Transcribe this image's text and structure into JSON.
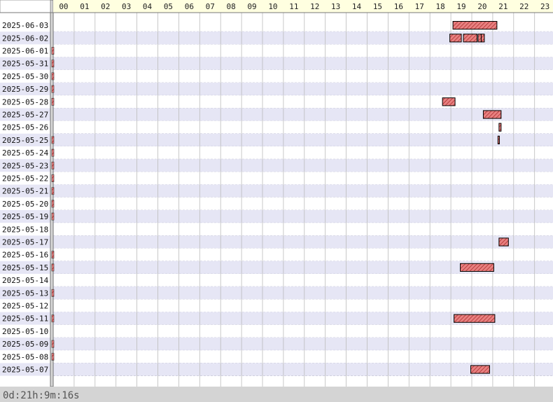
{
  "chart_data": {
    "type": "timeline",
    "hours": [
      "00",
      "01",
      "02",
      "03",
      "04",
      "05",
      "06",
      "07",
      "08",
      "09",
      "10",
      "11",
      "12",
      "13",
      "14",
      "15",
      "16",
      "17",
      "18",
      "19",
      "20",
      "21",
      "22",
      "23"
    ],
    "dates": [
      "2025-06-03",
      "2025-06-02",
      "2025-06-01",
      "2025-05-31",
      "2025-05-30",
      "2025-05-29",
      "2025-05-28",
      "2025-05-27",
      "2025-05-26",
      "2025-05-25",
      "2025-05-24",
      "2025-05-23",
      "2025-05-22",
      "2025-05-21",
      "2025-05-20",
      "2025-05-19",
      "2025-05-18",
      "2025-05-17",
      "2025-05-16",
      "2025-05-15",
      "2025-05-14",
      "2025-05-13",
      "2025-05-12",
      "2025-05-11",
      "2025-05-10",
      "2025-05-09",
      "2025-05-08",
      "2025-05-07"
    ],
    "marked_dates": [
      "2025-06-01",
      "2025-05-31",
      "2025-05-30",
      "2025-05-29",
      "2025-05-28",
      "2025-05-25",
      "2025-05-24",
      "2025-05-23",
      "2025-05-22",
      "2025-05-21",
      "2025-05-20",
      "2025-05-19",
      "2025-05-16",
      "2025-05-15",
      "2025-05-13",
      "2025-05-11",
      "2025-05-09",
      "2025-05-08"
    ],
    "bars": [
      {
        "date": "2025-06-03",
        "start": 19.1,
        "end": 21.2
      },
      {
        "date": "2025-06-02",
        "start": 18.95,
        "end": 19.5
      },
      {
        "date": "2025-06-02",
        "start": 19.6,
        "end": 20.25
      },
      {
        "date": "2025-06-02",
        "start": 20.3,
        "end": 20.45
      },
      {
        "date": "2025-06-02",
        "start": 20.45,
        "end": 20.6
      },
      {
        "date": "2025-05-28",
        "start": 18.6,
        "end": 19.2
      },
      {
        "date": "2025-05-27",
        "start": 20.55,
        "end": 21.4
      },
      {
        "date": "2025-05-26",
        "start": 21.3,
        "end": 21.4
      },
      {
        "date": "2025-05-25",
        "start": 21.25,
        "end": 21.32
      },
      {
        "date": "2025-05-17",
        "start": 21.3,
        "end": 21.75
      },
      {
        "date": "2025-05-15",
        "start": 19.45,
        "end": 21.05
      },
      {
        "date": "2025-05-11",
        "start": 19.15,
        "end": 21.1
      },
      {
        "date": "2025-05-07",
        "start": 19.95,
        "end": 20.85
      }
    ],
    "colors": {
      "row_odd": "#ffffff",
      "row_even": "#e6e6f5",
      "hour_header_bg": "#ffffe0",
      "bar_fill": "#e88080",
      "bar_stroke": "#000000",
      "grid": "#bbbbbb",
      "footer_bg": "#d4d4d4"
    },
    "footer": "0d:21h:9m:16s"
  }
}
